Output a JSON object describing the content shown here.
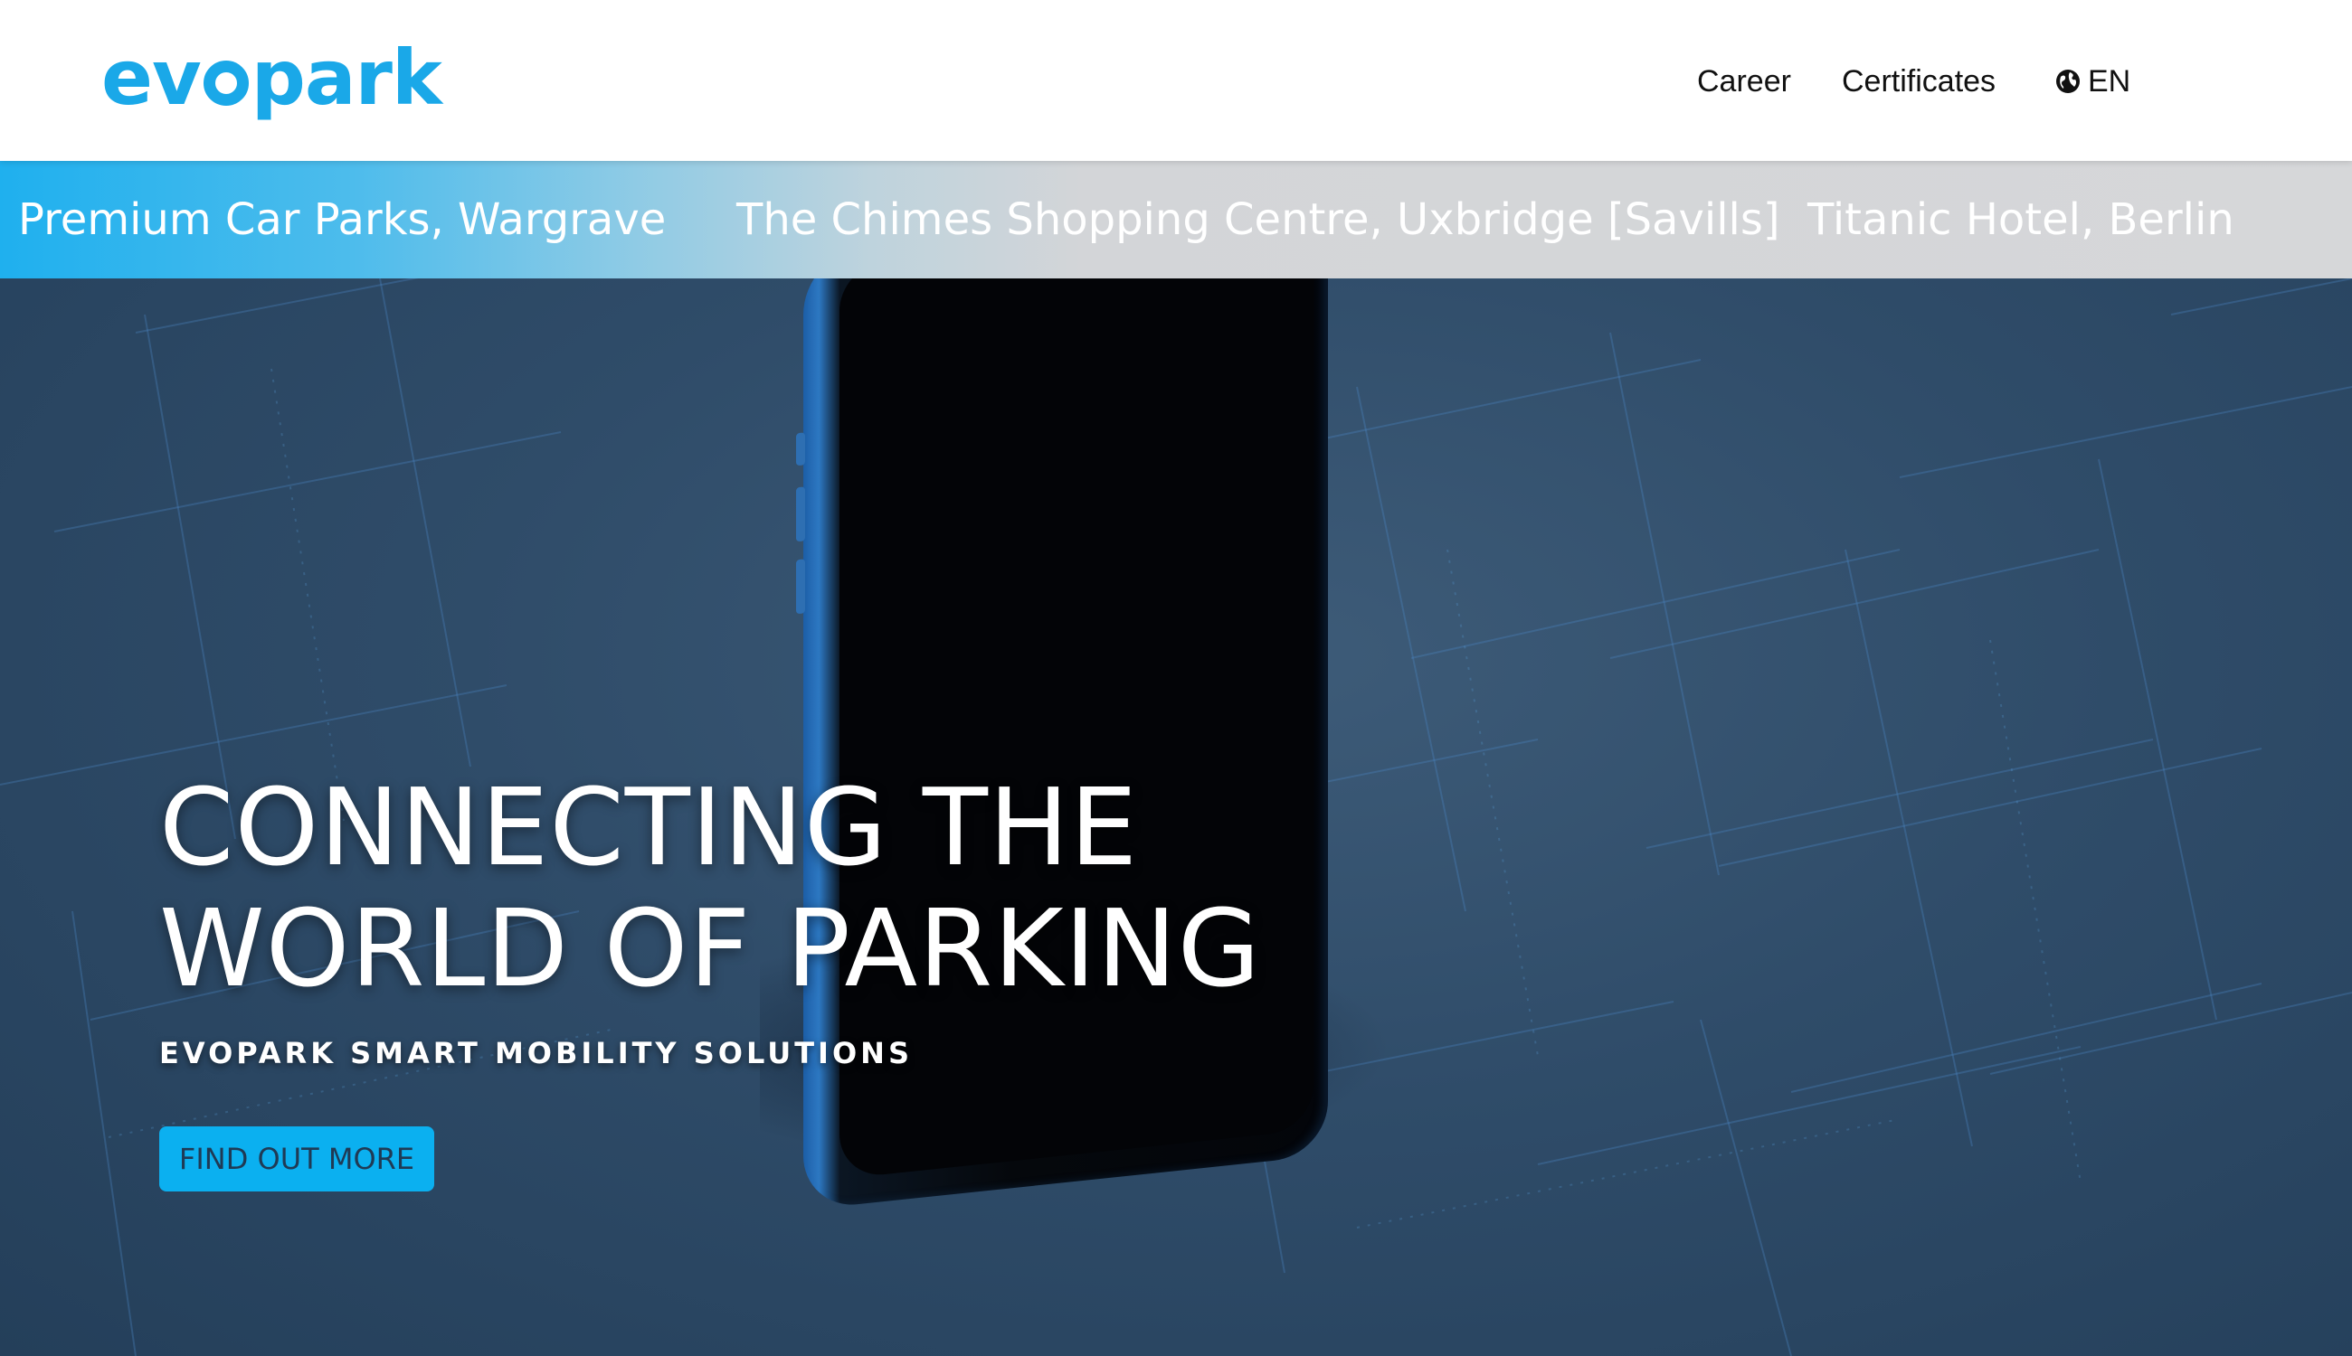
{
  "header": {
    "logo": {
      "brand_text": "evopark",
      "color": "#1aa8e8"
    },
    "nav": [
      {
        "label": "Career"
      },
      {
        "label": "Certificates"
      }
    ],
    "language": {
      "label": "EN",
      "icon": "globe-icon"
    }
  },
  "ticker": {
    "items": [
      {
        "label": "Premium Car Parks, Wargrave"
      },
      {
        "label": "The Chimes Shopping Centre, Uxbridge [Savills]"
      },
      {
        "label": "Titanic Hotel, Berlin"
      }
    ],
    "gradient_start": "#1fb0ee",
    "gradient_end": "#d6d7d9"
  },
  "hero": {
    "title_line1": "CONNECTING THE",
    "title_line2": "WORLD OF PARKING",
    "subtitle": "EVOPARK SMART MOBILITY SOLUTIONS",
    "cta_label": "FIND OUT MORE",
    "cta_color": "#0bb0f0",
    "background_color": "#2c4a66"
  }
}
